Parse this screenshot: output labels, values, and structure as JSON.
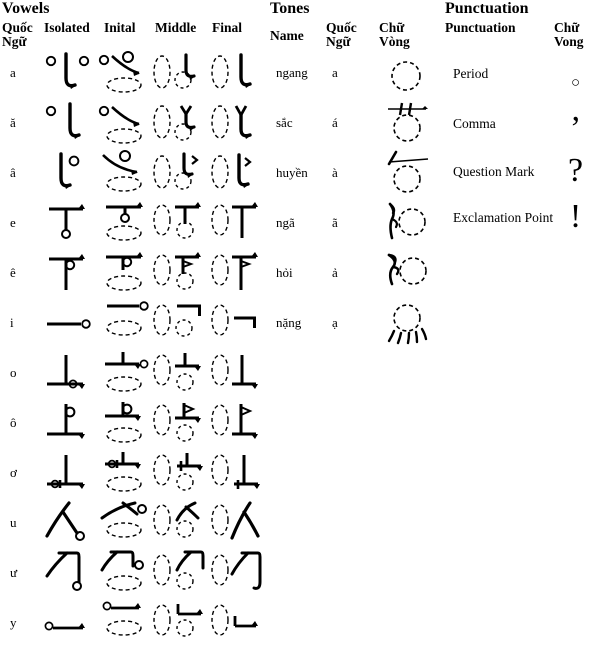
{
  "sections": {
    "vowels": {
      "title": "Vowels",
      "headers": [
        "Quốc Ngữ",
        "Isolated",
        "Inital",
        "Middle",
        "Final"
      ],
      "header_lines": [
        [
          "Quốc",
          "Ngữ"
        ],
        [
          "Isolated"
        ],
        [
          "Inital"
        ],
        [
          "Middle"
        ],
        [
          "Final"
        ]
      ],
      "rows": [
        {
          "quoc_ngu": "a",
          "glyphs": [
            "a-isolated",
            "a-initial",
            "a-middle",
            "a-final"
          ]
        },
        {
          "quoc_ngu": "ă",
          "glyphs": [
            "abreve-isolated",
            "abreve-initial",
            "abreve-middle",
            "abreve-final"
          ]
        },
        {
          "quoc_ngu": "â",
          "glyphs": [
            "acirc-isolated",
            "acirc-initial",
            "acirc-middle",
            "acirc-final"
          ]
        },
        {
          "quoc_ngu": "e",
          "glyphs": [
            "e-isolated",
            "e-initial",
            "e-middle",
            "e-final"
          ]
        },
        {
          "quoc_ngu": "ê",
          "glyphs": [
            "ecirc-isolated",
            "ecirc-initial",
            "ecirc-middle",
            "ecirc-final"
          ]
        },
        {
          "quoc_ngu": "i",
          "glyphs": [
            "i-isolated",
            "i-initial",
            "i-middle",
            "i-final"
          ]
        },
        {
          "quoc_ngu": "o",
          "glyphs": [
            "o-isolated",
            "o-initial",
            "o-middle",
            "o-final"
          ]
        },
        {
          "quoc_ngu": "ô",
          "glyphs": [
            "ocirc-isolated",
            "ocirc-initial",
            "ocirc-middle",
            "ocirc-final"
          ]
        },
        {
          "quoc_ngu": "ơ",
          "glyphs": [
            "ohorn-isolated",
            "ohorn-initial",
            "ohorn-middle",
            "ohorn-final"
          ]
        },
        {
          "quoc_ngu": "u",
          "glyphs": [
            "u-isolated",
            "u-initial",
            "u-middle",
            "u-final"
          ]
        },
        {
          "quoc_ngu": "ư",
          "glyphs": [
            "uhorn-isolated",
            "uhorn-initial",
            "uhorn-middle",
            "uhorn-final"
          ]
        },
        {
          "quoc_ngu": "y",
          "glyphs": [
            "y-isolated",
            "y-initial",
            "y-middle",
            "y-final"
          ]
        }
      ]
    },
    "tones": {
      "title": "Tones",
      "headers": [
        "Name",
        "Quốc Ngữ",
        "Chữ Vòng"
      ],
      "header_lines": [
        [
          "Name"
        ],
        [
          "Quốc",
          "Ngữ"
        ],
        [
          "Chữ",
          "Vòng"
        ]
      ],
      "rows": [
        {
          "name": "ngang",
          "quoc_ngu": "a",
          "glyph": "tone-ngang"
        },
        {
          "name": "sắc",
          "quoc_ngu": "á",
          "glyph": "tone-sac"
        },
        {
          "name": "huyền",
          "quoc_ngu": "à",
          "glyph": "tone-huyen"
        },
        {
          "name": "ngã",
          "quoc_ngu": "ã",
          "glyph": "tone-nga"
        },
        {
          "name": "hỏi",
          "quoc_ngu": "ả",
          "glyph": "tone-hoi"
        },
        {
          "name": "nặng",
          "quoc_ngu": "ạ",
          "glyph": "tone-nang"
        }
      ]
    },
    "punctuation": {
      "title": "Punctuation",
      "headers": [
        "Punctuation",
        "Chữ Vong"
      ],
      "header_lines": [
        [
          "Punctuation"
        ],
        [
          "Chữ",
          "Vong"
        ]
      ],
      "rows": [
        {
          "name": "Period",
          "mark": "○",
          "mark_name": "circle-mark",
          "size": "sm"
        },
        {
          "name": "Comma",
          "mark": "’",
          "mark_name": "comma-mark",
          "size": "bg"
        },
        {
          "name": "Question Mark",
          "mark": "?",
          "mark_name": "question-mark",
          "size": "bg"
        },
        {
          "name": "Exclamation Point",
          "mark": "!",
          "mark_name": "exclamation-mark",
          "size": "bg"
        }
      ]
    }
  },
  "colors": {
    "ink": "#000000",
    "background": "#ffffff",
    "dashed_guide": "#000000"
  }
}
